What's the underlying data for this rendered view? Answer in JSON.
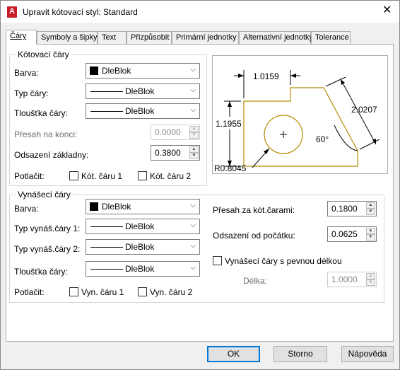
{
  "window": {
    "title": "Upravit kótovací styl: Standard",
    "app_icon": "A",
    "close": "✕"
  },
  "tabs": [
    "Čáry",
    "Symboly a šipky",
    "Text",
    "Přizpůsobit",
    "Primární jednotky",
    "Alternativní jednotky",
    "Tolerance"
  ],
  "dim_lines": {
    "title": "Kótovací čáry",
    "color_label": "Barva:",
    "color_value": "DleBlok",
    "linetype_label": "Typ čáry:",
    "linetype_value": "DleBlok",
    "lineweight_label": "Tloušťka čáry:",
    "lineweight_value": "DleBlok",
    "extend_label": "Přesah na konci:",
    "extend_value": "0.0000",
    "baseline_label": "Odsazení základny:",
    "baseline_value": "0.3800",
    "suppress_label": "Potlačit:",
    "suppress_1": "Kót. čáru 1",
    "suppress_2": "Kót. čáru 2"
  },
  "ext_lines": {
    "title": "Vynášecí čáry",
    "color_label": "Barva:",
    "color_value": "DleBlok",
    "linetype1_label": "Typ vynáš.čáry 1:",
    "linetype1_value": "DleBlok",
    "linetype2_label": "Typ vynáš.čáry 2:",
    "linetype2_value": "DleBlok",
    "lineweight_label": "Tloušťka čáry:",
    "lineweight_value": "DleBlok",
    "suppress_label": "Potlačit:",
    "suppress_1": "Vyn. čáru 1",
    "suppress_2": "Vyn. čáru 2",
    "extend_beyond_label": "Přesah za kót.čarami:",
    "extend_beyond_value": "0.1800",
    "offset_label": "Odsazení od počátku:",
    "offset_value": "0.0625",
    "fixed_length_label": "Vynášecí čáry s pevnou délkou",
    "length_label": "Délka:",
    "length_value": "1.0000"
  },
  "preview": {
    "dim_top": "1.0159",
    "dim_left": "1.1955",
    "dim_right": "2.0207",
    "angle": "60°",
    "radius": "R0.8045"
  },
  "buttons": {
    "ok": "OK",
    "cancel": "Storno",
    "help": "Nápověda"
  },
  "colors": {
    "preview_outline": "#b58b00",
    "accent": "#0078d7",
    "app_icon": "#c81c28"
  }
}
